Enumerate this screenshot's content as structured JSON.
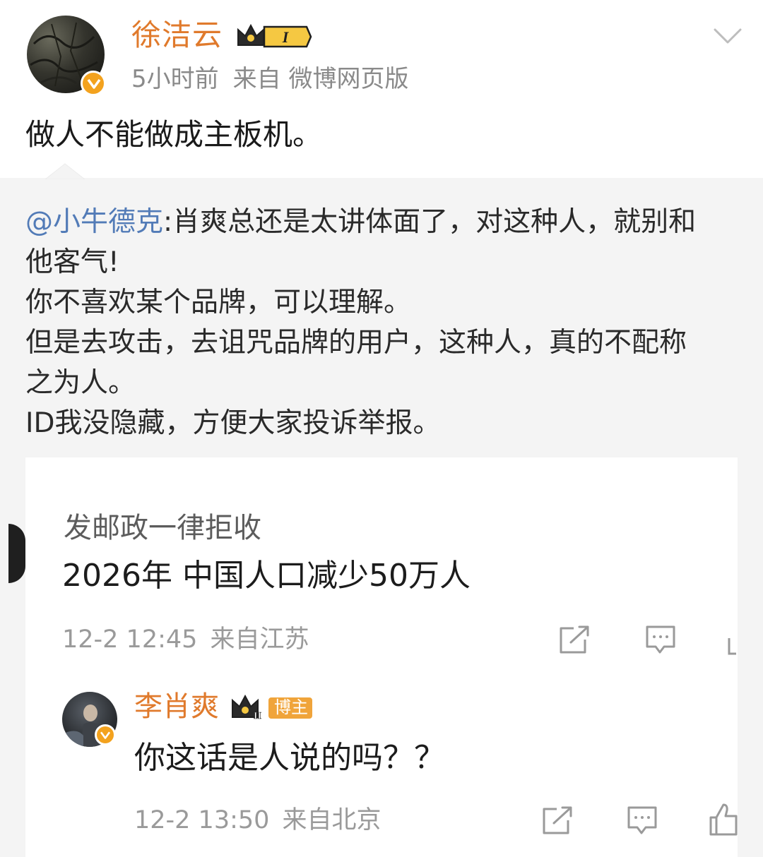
{
  "post": {
    "author": "徐洁云",
    "badge_level": "I",
    "time": "5小时前",
    "source": "来自 微博网页版",
    "text": "做人不能做成主板机。"
  },
  "repost": {
    "mention": "@小牛德克",
    "lines": [
      ":肖爽总还是太讲体面了，对这种人，就别和",
      "他客气!",
      "你不喜欢某个品牌，可以理解。",
      "但是去攻击，去诅咒品牌的用户，这种人，真的不配称",
      "之为人。",
      "ID我没隐藏，方便大家投诉举报。"
    ]
  },
  "comment": {
    "author": "发邮政一律拒收",
    "text": "2026年 中国人口减少50万人",
    "time": "12-2 12:45",
    "location": "来自江苏"
  },
  "reply": {
    "author": "李肖爽",
    "badge": "博主",
    "badge_level": "II",
    "text": "你这话是人说的吗？？",
    "time": "12-2 13:50",
    "location": "来自北京"
  },
  "colors": {
    "username": "#e07a2c",
    "mention": "#527bb7",
    "meta": "#8a8a8a",
    "repost_bg": "#f4f4f4",
    "verified": "#f3a21e",
    "badge_gold": "#f5c842"
  },
  "icons": [
    "chevron-down-icon",
    "verified-icon",
    "crown-badge-icon",
    "share-icon",
    "comment-icon",
    "like-icon"
  ]
}
